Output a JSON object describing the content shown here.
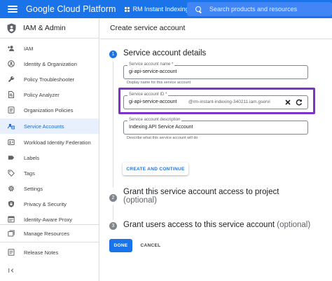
{
  "topbar": {
    "brand": "Google Cloud Platform",
    "project": "RM Instant Indexing",
    "search_placeholder": "Search products and resources"
  },
  "sidebar": {
    "title": "IAM & Admin",
    "items": [
      {
        "label": "IAM",
        "icon": "person-add-icon"
      },
      {
        "label": "Identity & Organization",
        "icon": "account-circle-icon"
      },
      {
        "label": "Policy Troubleshooter",
        "icon": "wrench-icon"
      },
      {
        "label": "Policy Analyzer",
        "icon": "document-search-icon"
      },
      {
        "label": "Organization Policies",
        "icon": "policy-list-icon"
      },
      {
        "label": "Service Accounts",
        "icon": "service-account-icon",
        "active": true
      },
      {
        "label": "Workload Identity Federation",
        "icon": "federation-icon"
      },
      {
        "label": "Labels",
        "icon": "label-icon"
      },
      {
        "label": "Tags",
        "icon": "tag-icon"
      },
      {
        "label": "Settings",
        "icon": "gear-icon"
      },
      {
        "label": "Privacy & Security",
        "icon": "shield-lock-icon"
      },
      {
        "label": "Identity-Aware Proxy",
        "icon": "proxy-icon"
      }
    ],
    "footer_items": [
      {
        "label": "Manage Resources",
        "icon": "folder-stack-icon"
      },
      {
        "label": "Release Notes",
        "icon": "notes-icon"
      }
    ],
    "collapse_label": "<|"
  },
  "main": {
    "page_title": "Create service account",
    "step1": {
      "number": "1",
      "title": "Service account details",
      "name_field": {
        "label": "Service account name *",
        "value": "gi-api-service-account",
        "help": "Display name for this service account"
      },
      "id_field": {
        "label": "Service account ID *",
        "value": "gi-api-service-account",
        "suffix": "@rm-instant-indexing-340211.iam.gservi"
      },
      "desc_field": {
        "label": "Service account description",
        "value": "Indexing API Service Account",
        "help": "Describe what this service account will do"
      },
      "create_button": "CREATE AND CONTINUE"
    },
    "step2": {
      "number": "2",
      "title": "Grant this service account access to project",
      "optional": "(optional)"
    },
    "step3": {
      "number": "3",
      "title": "Grant users access to this service account",
      "optional": "(optional)"
    },
    "done_button": "DONE",
    "cancel_button": "CANCEL"
  },
  "colors": {
    "topbar": "#1a73e8",
    "highlight": "#7b33c9",
    "active_nav_bg": "#e8f0fe",
    "primary": "#1a73e8"
  }
}
